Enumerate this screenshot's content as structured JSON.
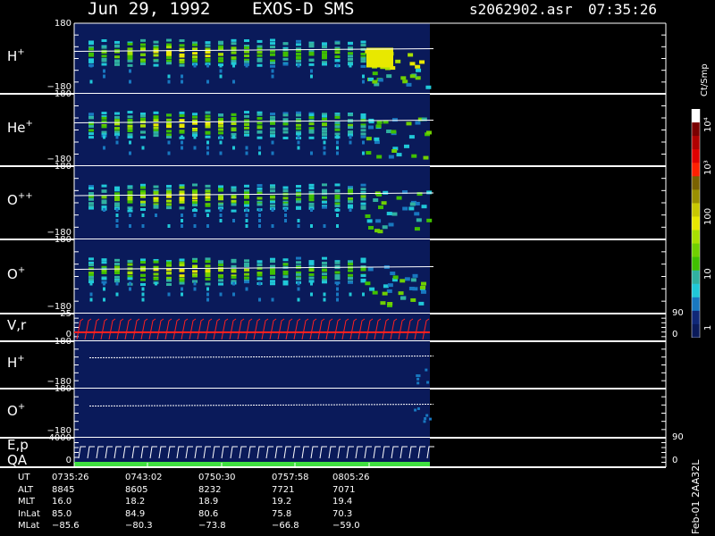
{
  "header": {
    "date": "Jun 29, 1992",
    "instrument": "EXOS-D SMS",
    "filename": "s2062902.asr",
    "start_time": "07:35:26"
  },
  "panels": [
    {
      "label": "H",
      "charge": "+",
      "tick_top": "180",
      "tick_bottom": "−180"
    },
    {
      "label": "He",
      "charge": "+",
      "tick_top": "180",
      "tick_bottom": "−180"
    },
    {
      "label": "O",
      "charge": "++",
      "tick_top": "180",
      "tick_bottom": "−180"
    },
    {
      "label": "O",
      "charge": "+",
      "tick_top": "180",
      "tick_bottom": "−180"
    },
    {
      "label": "V,r",
      "charge": "",
      "tick_top": "25",
      "tick_bottom": "0",
      "right_top": "90",
      "right_bottom": "0"
    },
    {
      "label": "H",
      "charge": "+",
      "tick_top": "180",
      "tick_bottom": "−180"
    },
    {
      "label": "O",
      "charge": "+",
      "tick_top": "180",
      "tick_bottom": "−180"
    },
    {
      "label": "E,p",
      "label2": "QA",
      "charge": "",
      "tick_top": "4000",
      "tick_bottom": "0",
      "right_top": "90",
      "right_bottom": "0"
    }
  ],
  "colorbar": {
    "unit": "Ct/Smp",
    "labels": [
      "10⁴",
      "10³",
      "100",
      "10",
      "1"
    ],
    "colors": [
      "#ffffff",
      "#7a0000",
      "#b00000",
      "#e00000",
      "#ff2000",
      "#7a6200",
      "#9a9000",
      "#c8c800",
      "#e8e800",
      "#a8e000",
      "#70d000",
      "#40c000",
      "#30b0a0",
      "#20c8d8",
      "#1878c0",
      "#102878",
      "#0a1a5a"
    ]
  },
  "ephemeris": {
    "row_labels": [
      "UT",
      "ALT",
      "MLT",
      "InLat",
      "MLat"
    ],
    "columns": [
      {
        "UT": "0735:26",
        "ALT": "8845",
        "MLT": "16.0",
        "InLat": "85.0",
        "MLat": "−85.6"
      },
      {
        "UT": "0743:02",
        "ALT": "8605",
        "MLT": "18.2",
        "InLat": "84.9",
        "MLat": "−80.3"
      },
      {
        "UT": "0750:30",
        "ALT": "8232",
        "MLT": "18.9",
        "InLat": "80.6",
        "MLat": "−73.8"
      },
      {
        "UT": "0757:58",
        "ALT": "7721",
        "MLT": "19.2",
        "InLat": "75.8",
        "MLat": "−66.8"
      },
      {
        "UT": "0805:26",
        "ALT": "7071",
        "MLT": "19.4",
        "InLat": "70.3",
        "MLat": "−59.0"
      }
    ]
  },
  "footer_note": "Feb-01 2AA32L",
  "colors": {
    "background": "#000000",
    "plot_bg": "#0a1a5a",
    "velocity": "#ff2020",
    "qa": "#40e040"
  },
  "chart_data": {
    "type": "heatmap",
    "title": "Jun 29, 1992   EXOS-D SMS",
    "panels": [
      "H+",
      "He+",
      "O++",
      "O+",
      "V,r",
      "H+",
      "O+",
      "E,p QA"
    ],
    "pitch_angle_range": [
      -180,
      180
    ],
    "velocity_range": [
      0,
      25
    ],
    "energy_range": [
      0,
      4000
    ],
    "time_labels": [
      "0735:26",
      "0743:02",
      "0750:30",
      "0757:58",
      "0805:26"
    ],
    "colorbar_scale": "log",
    "colorbar_range": [
      1,
      10000
    ],
    "colorbar_unit": "Ct/Smp"
  }
}
